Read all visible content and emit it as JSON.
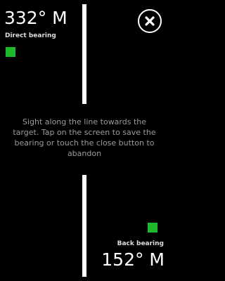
{
  "direct": {
    "value": "332° M",
    "label": "Direct bearing",
    "marker_color": "#1db92a"
  },
  "back": {
    "value": "152° M",
    "label": "Back bearing",
    "marker_color": "#1db92a"
  },
  "instructions": "Sight along the line towards the target. Tap on the screen to save the bearing or touch the close button to abandon",
  "close_button": {
    "icon": "close-icon"
  },
  "colors": {
    "background": "#000000",
    "line": "#ffffff",
    "instructions_text": "#9a9a9a"
  }
}
